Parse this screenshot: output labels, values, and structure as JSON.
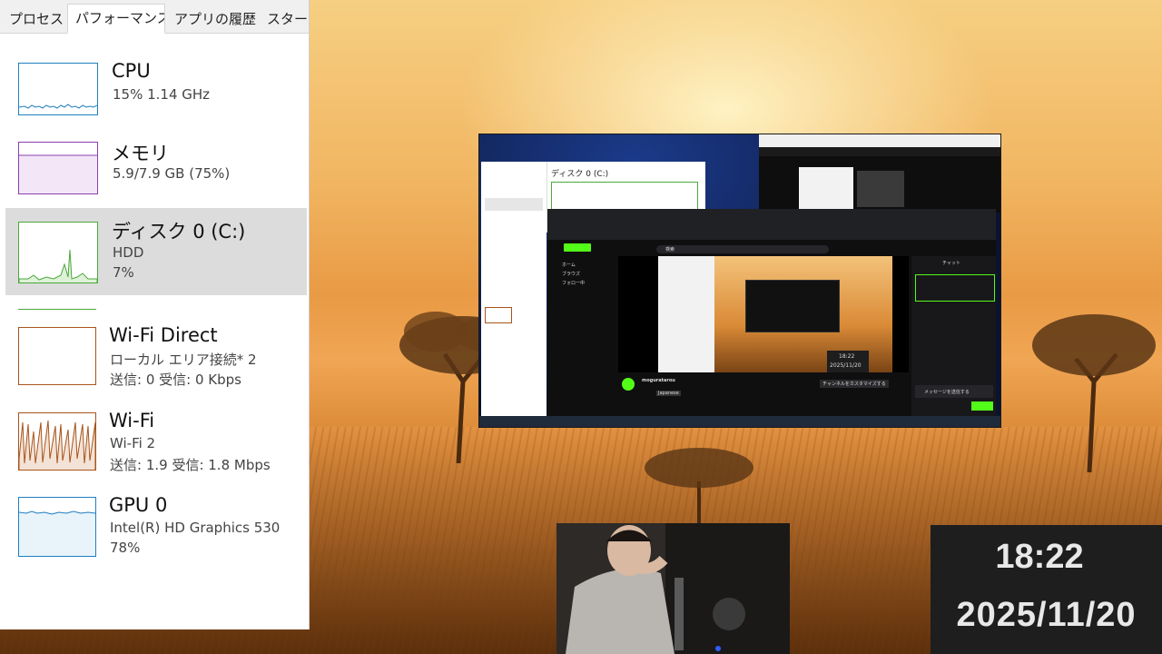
{
  "taskmanager": {
    "tabs": [
      "プロセス",
      "パフォーマンス",
      "アプリの履歴",
      "スタート"
    ],
    "active_tab": "パフォーマンス",
    "items": [
      {
        "title": "CPU",
        "line1": "15%  1.14 GHz",
        "line2": ""
      },
      {
        "title": "メモリ",
        "line1": "5.9/7.9 GB (75%)",
        "line2": ""
      },
      {
        "title": "ディスク 0 (C:)",
        "line1": "HDD",
        "line2": "7%"
      },
      {
        "title": "Wi-Fi Direct",
        "line1": "ローカル エリア接続* 2",
        "line2": "送信: 0 受信: 0 Kbps"
      },
      {
        "title": "Wi-Fi",
        "line1": "Wi-Fi 2",
        "line2": "送信: 1.9 受信: 1.8 Mbps"
      },
      {
        "title": "GPU 0",
        "line1": "Intel(R) HD Graphics 530",
        "line2": "78%"
      }
    ],
    "colors": {
      "cpu": "#1f7fbf",
      "memory": "#8b3fae",
      "disk": "#4aa93a",
      "wifi": "#a8541b",
      "gpu": "#1f7fbf"
    }
  },
  "capture": {
    "disk_title": "ディスク 0 (C:)",
    "kick_nav": [
      "ホーム",
      "ブラウズ",
      "フォロー中"
    ],
    "streamer": "moguratarou",
    "stream_tag": "Japanese",
    "chat_title": "チャット",
    "chat_placeholder": "メッセージを送信する",
    "customize_btn": "チャンネルをカスタマイズする",
    "overlay_time": "18:22",
    "overlay_date": "2025/11/20",
    "search_placeholder": "検索"
  },
  "clock": {
    "time": "18:22",
    "date": "2025/11/20"
  }
}
